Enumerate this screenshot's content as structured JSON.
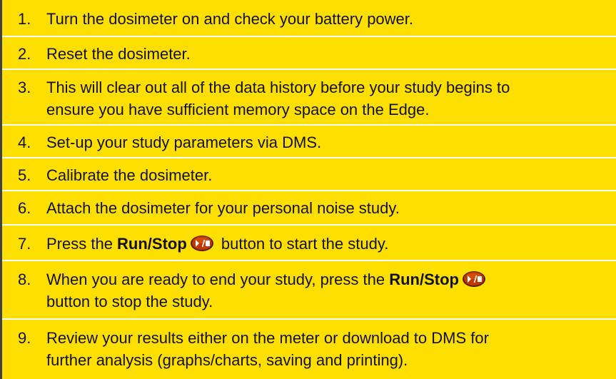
{
  "steps": [
    {
      "num": "1.",
      "text": "Turn the dosimeter on and check your battery power."
    },
    {
      "num": "2.",
      "text": "Reset the dosimeter."
    },
    {
      "num": "3.",
      "line1": "This will clear out all of the data history before your study begins to",
      "line2": "ensure you have sufficient memory space on the Edge."
    },
    {
      "num": "4.",
      "text": "Set-up your study parameters via DMS."
    },
    {
      "num": "5.",
      "text": "Calibrate the dosimeter."
    },
    {
      "num": "6.",
      "text": "Attach the dosimeter for your personal noise study."
    },
    {
      "num": "7.",
      "before": "Press the ",
      "bold": "Run/Stop",
      "after": " button to start the study."
    },
    {
      "num": "8.",
      "before": "When you are ready to end your study, press the ",
      "bold": "Run/Stop",
      "line2": "button to stop the study."
    },
    {
      "num": "9.",
      "line1": "Review your results either on the meter or download to DMS for",
      "line2": "further analysis (graphs/charts, saving and printing)."
    }
  ],
  "colors": {
    "panel": "#ffdf00",
    "divider": "#ffffff",
    "left_border": "#404040",
    "icon_body": "#c33800",
    "icon_rim": "#5a1d00"
  },
  "icons": {
    "run_stop": "run-stop-button-icon"
  }
}
